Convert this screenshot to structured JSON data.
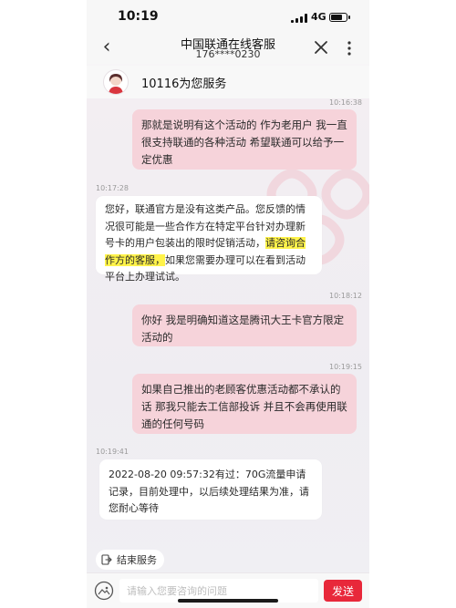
{
  "status": {
    "time": "10:19",
    "network": "4G"
  },
  "nav": {
    "back": "‹",
    "title": "中国联通在线客服",
    "subtitle": "176****0230"
  },
  "agent": {
    "name": "10116为您服务"
  },
  "messages": [
    {
      "role": "user",
      "time": "10:16:38",
      "text": "那就是说明有这个活动的 作为老用户 我一直很支持联通的各种活动 希望联通可以给予一定优惠"
    },
    {
      "role": "agent",
      "time": "10:17:28",
      "text_before": "您好，联通官方是没有这类产品。您反馈的情况很可能是一些合作方在特定平台针对办理新号卡的用户包装出的限时促销活动，",
      "highlight": "请咨询合作方的客服，",
      "text_after": "如果您需要办理可以在看到活动平台上办理试试。"
    },
    {
      "role": "user",
      "time": "10:18:12",
      "text": "你好 我是明确知道这是腾讯大王卡官方限定活动的"
    },
    {
      "role": "user",
      "time": "10:19:15",
      "text": "如果自己推出的老顾客优惠活动都不承认的话 那我只能去工信部投诉 并且不会再使用联通的任何号码"
    },
    {
      "role": "agent",
      "time": "10:19:41",
      "text": "2022-08-20 09:57:32有过：70G流量申请记录，目前处理中，以后续处理结果为准，请您耐心等待"
    }
  ],
  "end_service": {
    "label": "结束服务"
  },
  "input": {
    "placeholder": "请输入您要咨询的问题",
    "value": ""
  },
  "send": {
    "label": "发送"
  },
  "colors": {
    "accent": "#e8283a",
    "user_bubble": "#f6d3da",
    "highlight": "#fff34a"
  }
}
